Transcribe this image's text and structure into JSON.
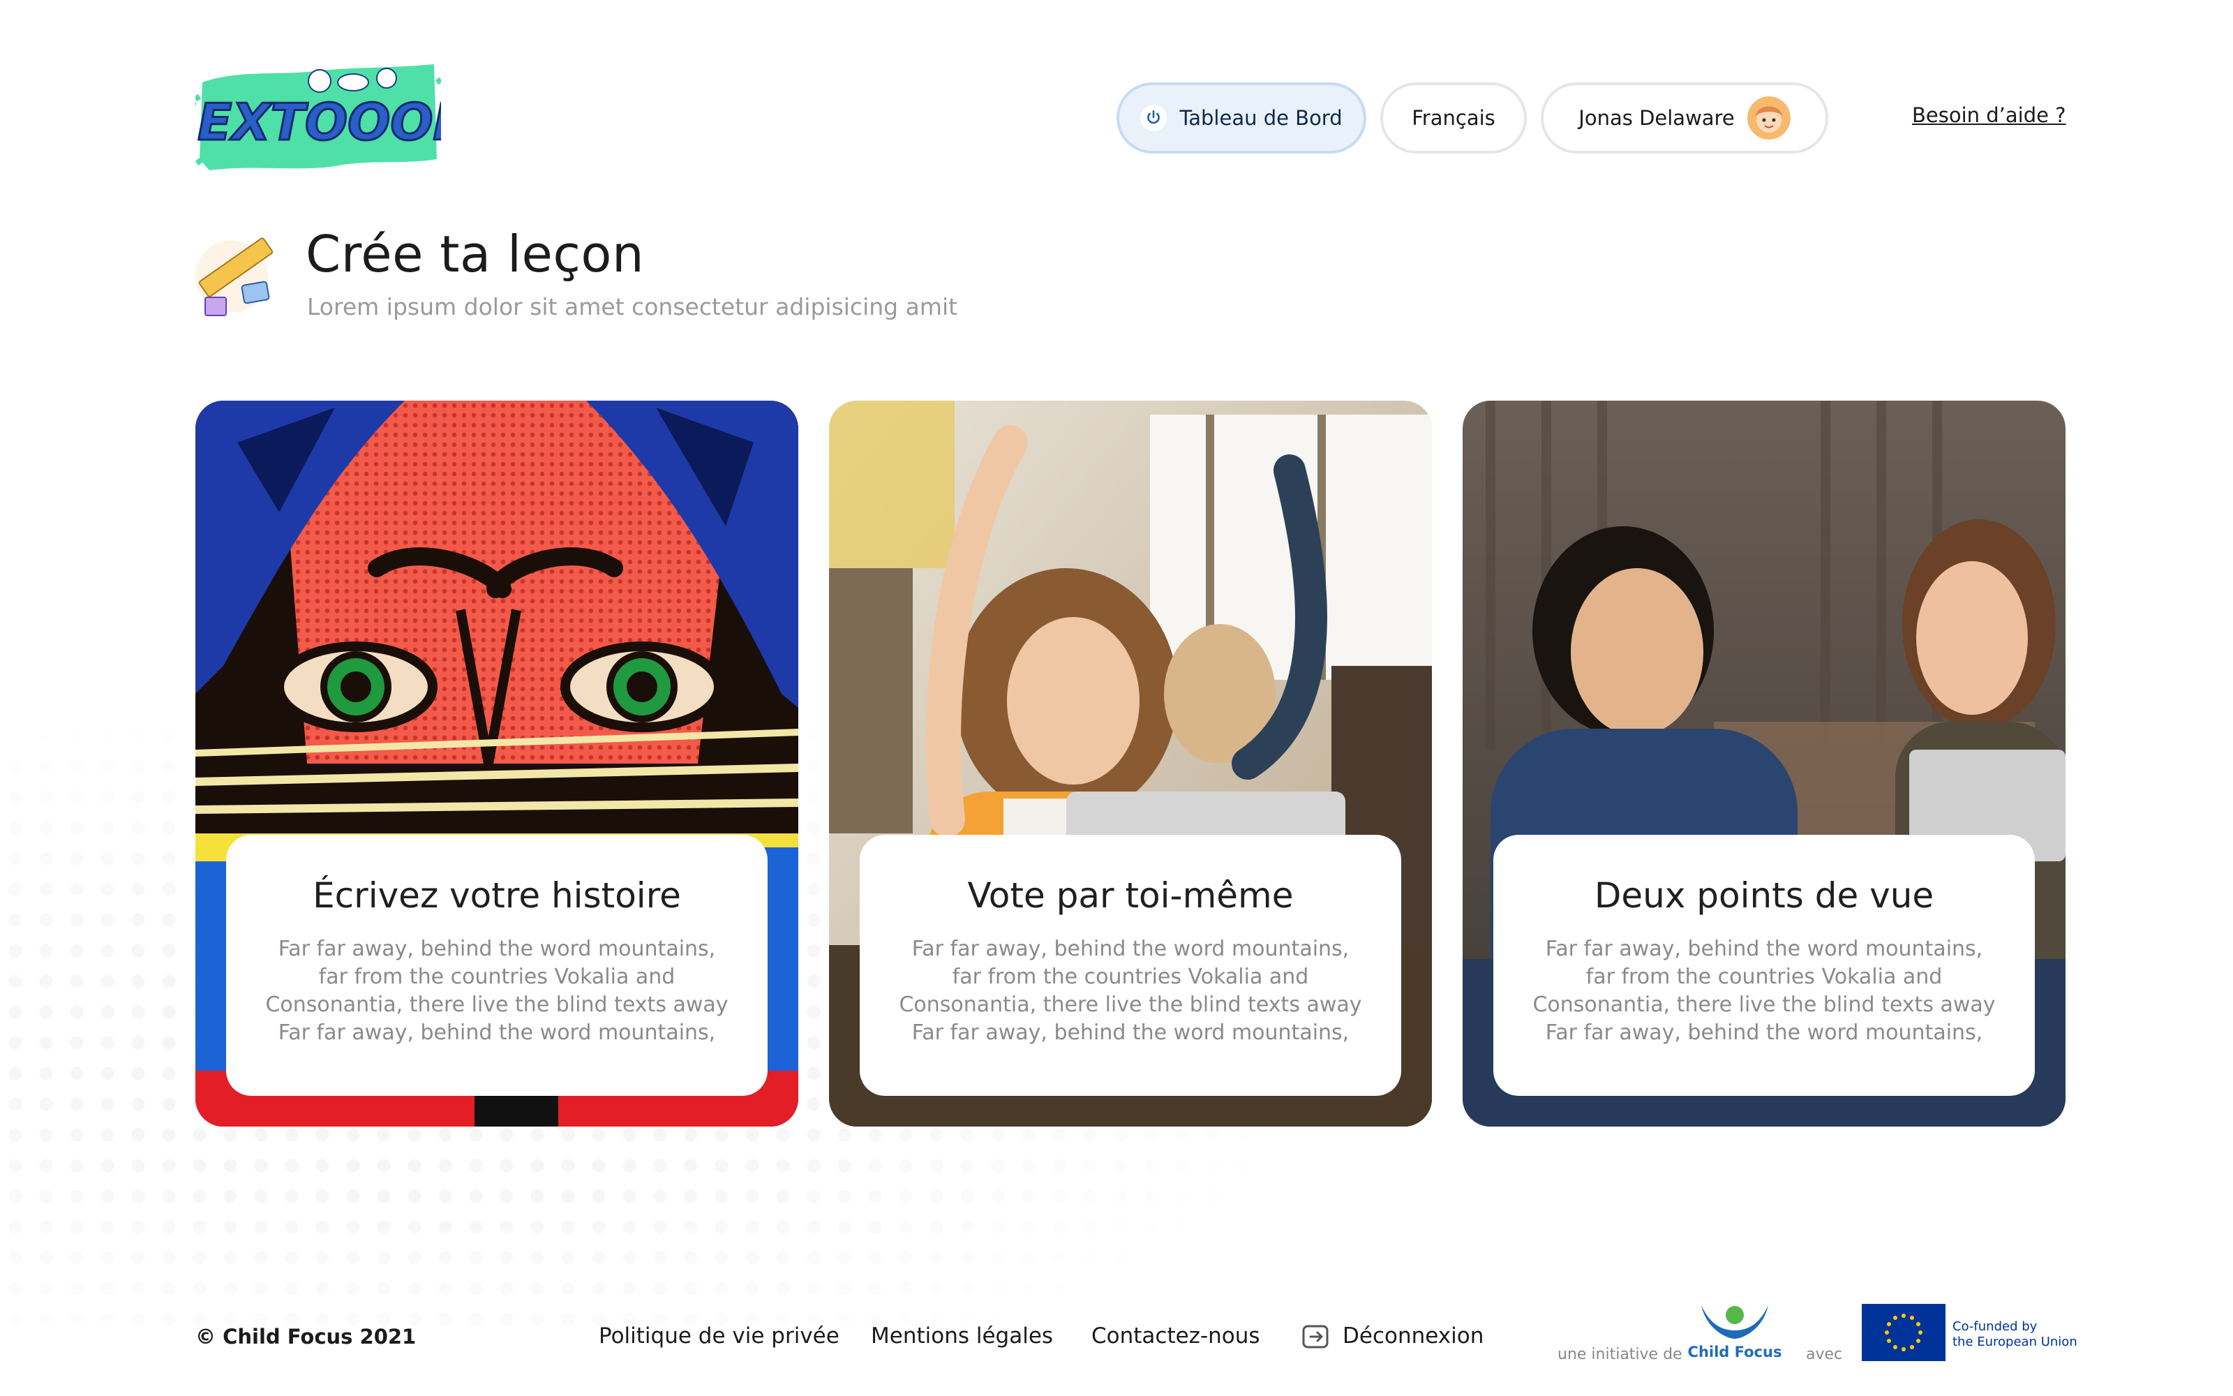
{
  "header": {
    "logo_text": "SEXTOOOH",
    "nav": {
      "dashboard": "Tableau de Bord",
      "language": "Français",
      "user": "Jonas Delaware",
      "help": "Besoin d’aide ?"
    }
  },
  "page": {
    "title": "Crée ta leçon",
    "subtitle": "Lorem ipsum dolor sit amet consectetur adipisicing amit"
  },
  "cards": [
    {
      "title": "Écrivez votre histoire",
      "text": "Far far away, behind the word mountains,\nfar from the countries Vokalia and\nConsonantia, there live the blind texts away\nFar far away, behind the word mountains,"
    },
    {
      "title": "Vote par toi-même",
      "text": "Far far away, behind the word mountains,\nfar from the countries Vokalia and\nConsonantia, there live the blind texts away\nFar far away, behind the word mountains,"
    },
    {
      "title": "Deux points de vue",
      "text": "Far far away, behind the word mountains,\nfar from the countries Vokalia and\nConsonantia, there live the blind texts away\nFar far away, behind the word mountains,"
    }
  ],
  "footer": {
    "copyright": "© Child Focus 2021",
    "links": [
      "Politique de vie privée",
      "Mentions légales",
      "Contactez-nous",
      "Déconnexion"
    ],
    "initiative_label": "une initiative de",
    "childfocus_label": "Child Focus",
    "with_label": "avec",
    "eu_label": "Co-funded by\nthe European Union"
  },
  "colors": {
    "accent_blue": "#1b5fae",
    "logo_green": "#4fe0a8",
    "pill_active_bg": "#e9f1fb",
    "eu_blue": "#003399"
  },
  "icons": [
    "power-icon",
    "avatar",
    "logout-icon",
    "ruler-icon"
  ]
}
